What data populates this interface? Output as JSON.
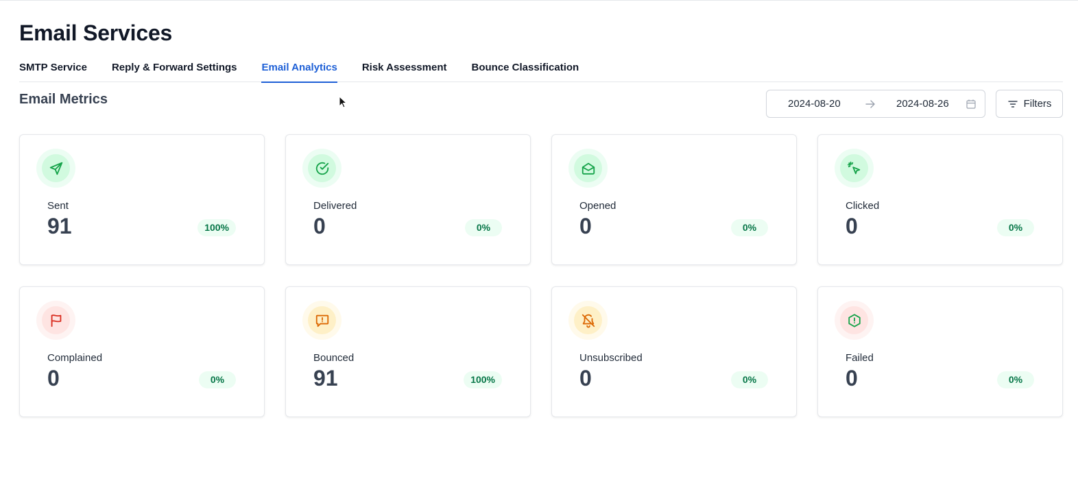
{
  "page": {
    "title": "Email Services"
  },
  "tabs": [
    {
      "label": "SMTP Service",
      "active": false
    },
    {
      "label": "Reply & Forward Settings",
      "active": false
    },
    {
      "label": "Email Analytics",
      "active": true
    },
    {
      "label": "Risk Assessment",
      "active": false
    },
    {
      "label": "Bounce Classification",
      "active": false
    }
  ],
  "section": {
    "title": "Email Metrics"
  },
  "date_range": {
    "start": "2024-08-20",
    "end": "2024-08-26"
  },
  "filters": {
    "label": "Filters"
  },
  "metrics": [
    {
      "label": "Sent",
      "value": "91",
      "percent": "100%",
      "icon": "send-icon",
      "tone": "green"
    },
    {
      "label": "Delivered",
      "value": "0",
      "percent": "0%",
      "icon": "check-circle-icon",
      "tone": "green"
    },
    {
      "label": "Opened",
      "value": "0",
      "percent": "0%",
      "icon": "mail-open-icon",
      "tone": "green"
    },
    {
      "label": "Clicked",
      "value": "0",
      "percent": "0%",
      "icon": "click-pointer-icon",
      "tone": "green"
    },
    {
      "label": "Complained",
      "value": "0",
      "percent": "0%",
      "icon": "flag-icon",
      "tone": "red"
    },
    {
      "label": "Bounced",
      "value": "91",
      "percent": "100%",
      "icon": "message-alert-icon",
      "tone": "orange"
    },
    {
      "label": "Unsubscribed",
      "value": "0",
      "percent": "0%",
      "icon": "bell-off-icon",
      "tone": "orange"
    },
    {
      "label": "Failed",
      "value": "0",
      "percent": "0%",
      "icon": "hexagon-alert-icon",
      "tone": "red"
    }
  ],
  "colors": {
    "accent": "#1d5fd6",
    "green_icon": "#16a34a",
    "red_icon": "#d92d20",
    "orange_icon": "#dc6803",
    "badge_bg": "#ecfdf3",
    "badge_text": "#067647"
  }
}
